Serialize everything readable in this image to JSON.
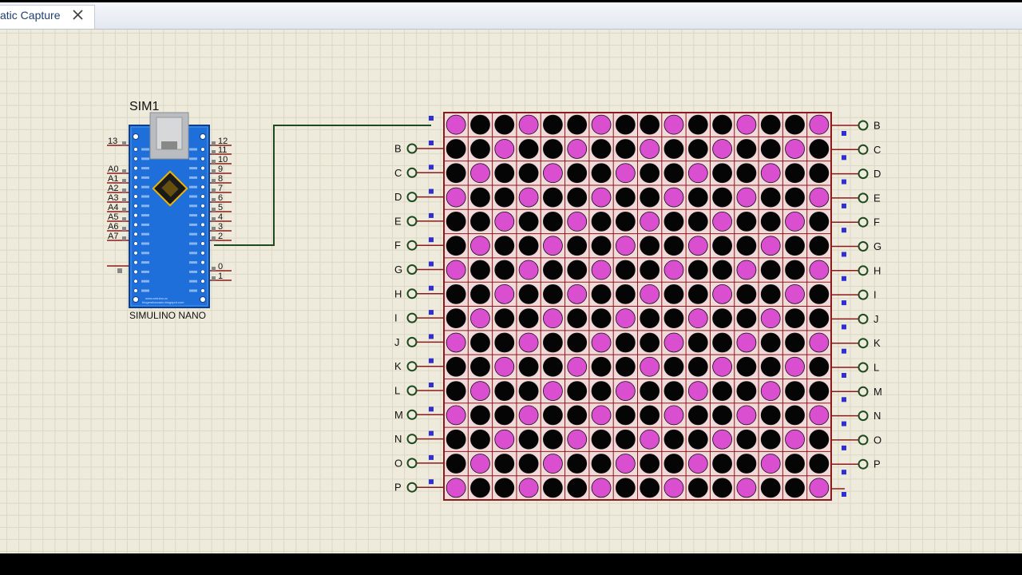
{
  "tab": {
    "title": "atic Capture",
    "close_icon": "close-icon"
  },
  "board": {
    "ref": "SIM1",
    "name": "SIMULINO NANO",
    "left_pins": [
      "13",
      "A0",
      "A1",
      "A2",
      "A3",
      "A4",
      "A5",
      "A6",
      "A7"
    ],
    "right_pins": [
      "12",
      "11",
      "10",
      "9",
      "8",
      "7",
      "6",
      "5",
      "4",
      "3",
      "2",
      "0",
      "1"
    ],
    "color": "#1e6fd9"
  },
  "matrix": {
    "rows": 16,
    "cols": 16,
    "left_labels": [
      "B",
      "C",
      "D",
      "E",
      "F",
      "G",
      "H",
      "I",
      "J",
      "K",
      "L",
      "M",
      "N",
      "O",
      "P"
    ],
    "right_labels": [
      "B",
      "C",
      "D",
      "E",
      "F",
      "G",
      "H",
      "I",
      "J",
      "K",
      "L",
      "M",
      "N",
      "O",
      "P"
    ],
    "pattern": [
      "1001001001001001",
      "0010010010010010",
      "0100100100100100",
      "1001001001001001",
      "0010010010010010",
      "0100100100100100",
      "1001001001001001",
      "0010010010010010",
      "0100100100100100",
      "1001001001001001",
      "0010010010010010",
      "0100100100100100",
      "1001001001001001",
      "0010010010010010",
      "0100100100100100",
      "1001001001001001"
    ],
    "on_color": "#d94fd0",
    "off_color": "#050505",
    "frame_color": "#8b1a1a"
  },
  "wire_color": "#1f4a1f"
}
